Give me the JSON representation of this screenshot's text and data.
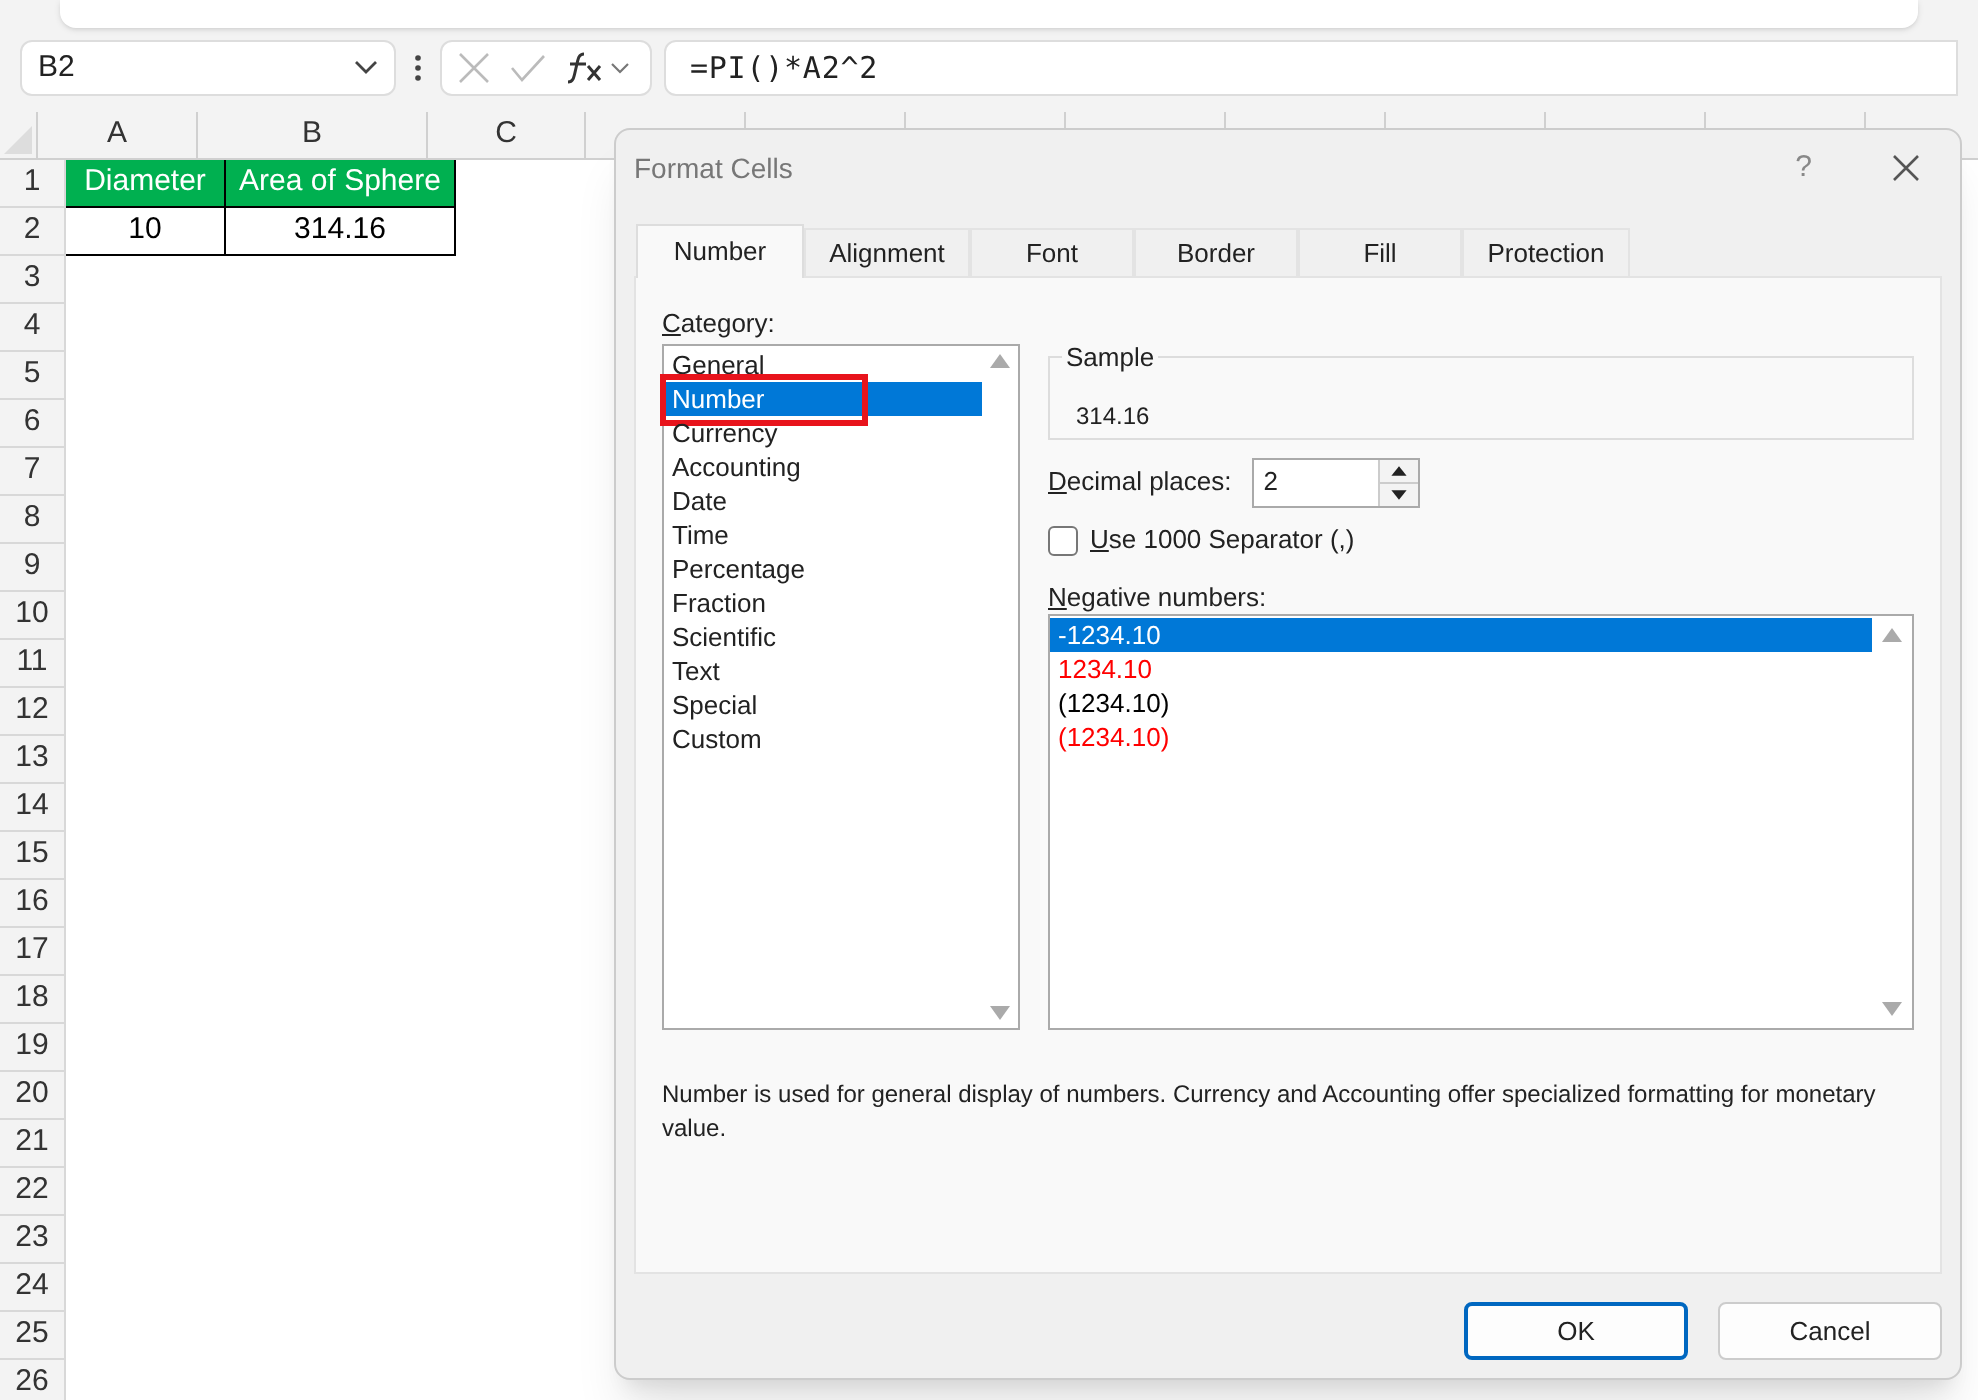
{
  "formula_bar": {
    "name_box": "B2",
    "formula": "=PI()*A2^2"
  },
  "sheet": {
    "columns": [
      "A",
      "B",
      "C"
    ],
    "rows": [
      "1",
      "2",
      "3",
      "4",
      "5",
      "6",
      "7",
      "8",
      "9",
      "10",
      "11",
      "12",
      "13",
      "14",
      "15",
      "16",
      "17",
      "18",
      "19",
      "20",
      "21",
      "22",
      "23",
      "24",
      "25",
      "26"
    ],
    "data_rows": [
      [
        {
          "text": "Diameter",
          "kind": "header"
        },
        {
          "text": "Area of Sphere",
          "kind": "header"
        }
      ],
      [
        {
          "text": "10",
          "kind": "value"
        },
        {
          "text": "314.16",
          "kind": "value"
        }
      ]
    ]
  },
  "dialog": {
    "title": "Format Cells",
    "help": "?",
    "tabs": [
      {
        "label": "Number",
        "selected": true
      },
      {
        "label": "Alignment",
        "selected": false
      },
      {
        "label": "Font",
        "selected": false
      },
      {
        "label": "Border",
        "selected": false
      },
      {
        "label": "Fill",
        "selected": false
      },
      {
        "label": "Protection",
        "selected": false
      }
    ],
    "category_label": "Category:",
    "categories": [
      {
        "label": "General",
        "selected": false,
        "highlighted": false
      },
      {
        "label": "Number",
        "selected": true,
        "highlighted": true
      },
      {
        "label": "Currency",
        "selected": false,
        "highlighted": false
      },
      {
        "label": "Accounting",
        "selected": false,
        "highlighted": false
      },
      {
        "label": "Date",
        "selected": false,
        "highlighted": false
      },
      {
        "label": "Time",
        "selected": false,
        "highlighted": false
      },
      {
        "label": "Percentage",
        "selected": false,
        "highlighted": false
      },
      {
        "label": "Fraction",
        "selected": false,
        "highlighted": false
      },
      {
        "label": "Scientific",
        "selected": false,
        "highlighted": false
      },
      {
        "label": "Text",
        "selected": false,
        "highlighted": false
      },
      {
        "label": "Special",
        "selected": false,
        "highlighted": false
      },
      {
        "label": "Custom",
        "selected": false,
        "highlighted": false
      }
    ],
    "sample": {
      "label": "Sample",
      "value": "314.16"
    },
    "decimal_places": {
      "label": "Decimal places:",
      "value": "2"
    },
    "separator": {
      "label": "Use 1000 Separator (,)",
      "checked": false
    },
    "negative_label": "Negative numbers:",
    "negative_numbers": [
      {
        "label": "-1234.10",
        "selected": true
      },
      {
        "label": "1234.10",
        "selected": false,
        "color": "#ff0000"
      },
      {
        "label": "(1234.10)",
        "selected": false,
        "color": "#000000"
      },
      {
        "label": "(1234.10)",
        "selected": false,
        "color": "#ff0000"
      }
    ],
    "description": "Number is used for general display of numbers.  Currency and Accounting offer specialized formatting for monetary value.",
    "buttons": [
      "OK",
      "Cancel"
    ]
  }
}
